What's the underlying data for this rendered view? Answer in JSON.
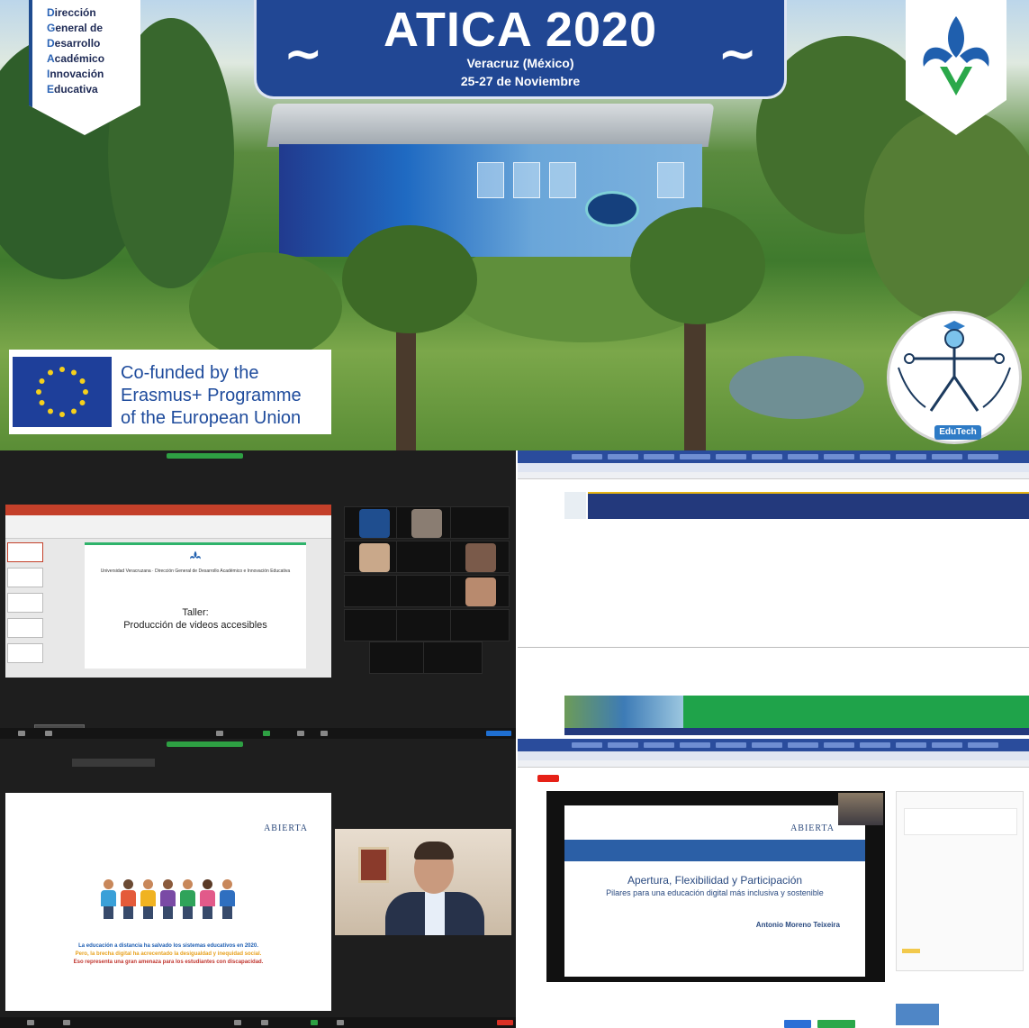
{
  "banner": {
    "dgdai_lines": [
      {
        "initial": "D",
        "rest": "irección"
      },
      {
        "initial": "G",
        "rest": "eneral de"
      },
      {
        "initial": "D",
        "rest": "esarrollo"
      },
      {
        "initial": "A",
        "rest": "cadémico"
      },
      {
        "initial": "I",
        "rest": "nnovación"
      },
      {
        "initial": "E",
        "rest": "ducativa"
      }
    ],
    "title": "ATICA 2020",
    "place": "Veracruz (México)",
    "dates": "25-27 de Noviembre",
    "erasmus_lines": [
      "Co-funded by the",
      "Erasmus+ Programme",
      "of the European Union"
    ],
    "edutech_label": "EduTech",
    "colors": {
      "title_bg": "#214794",
      "eu_blue": "#1e3f9a",
      "eu_star": "#f5d01c",
      "uv_green": "#2aa84a"
    },
    "icons": [
      "uv-fleur-de-lis-icon",
      "eu-flag-icon",
      "edutech-vitruvian-icon"
    ]
  },
  "q1": {
    "slide_uni": "Universidad Veracruzana · Dirección General de Desarrollo Académico e Innovación Educativa",
    "slide_title_1": "Taller:",
    "slide_title_2": "Producción de videos accesibles"
  },
  "q3": {
    "quote_line_1": "La educación a distancia ha salvado los sistemas educativos en 2020.",
    "quote_line_2": "Pero, la brecha digital ha acrecentado la desigualdad y inequidad social.",
    "quote_line_3": "Eso representa una gran amenaza para los estudiantes con discapacidad.",
    "abierta": "ABIERTA"
  },
  "q4": {
    "abierta": "ABIERTA",
    "talk_title": "Apertura, Flexibilidad y Participación",
    "talk_subtitle": "Pilares para una educación digital más inclusiva y sostenible",
    "author": "Antonio Moreno Teixeira"
  }
}
